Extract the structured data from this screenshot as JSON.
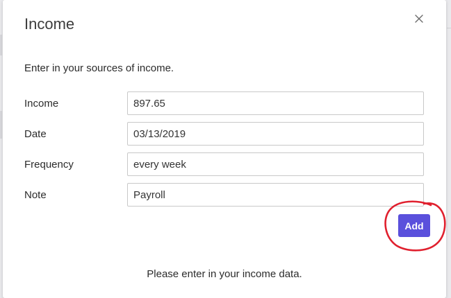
{
  "dialog": {
    "title": "Income",
    "intro": "Enter in your sources of income.",
    "close_icon": "close-icon",
    "fields": {
      "income": {
        "label": "Income",
        "value": "897.65"
      },
      "date": {
        "label": "Date",
        "value": "03/13/2019"
      },
      "frequency": {
        "label": "Frequency",
        "value": "every week"
      },
      "note": {
        "label": "Note",
        "value": "Payroll"
      }
    },
    "add_label": "Add",
    "status": "Please enter in your income data."
  },
  "colors": {
    "accent": "#5a50dc",
    "annotation": "#e0202e"
  }
}
